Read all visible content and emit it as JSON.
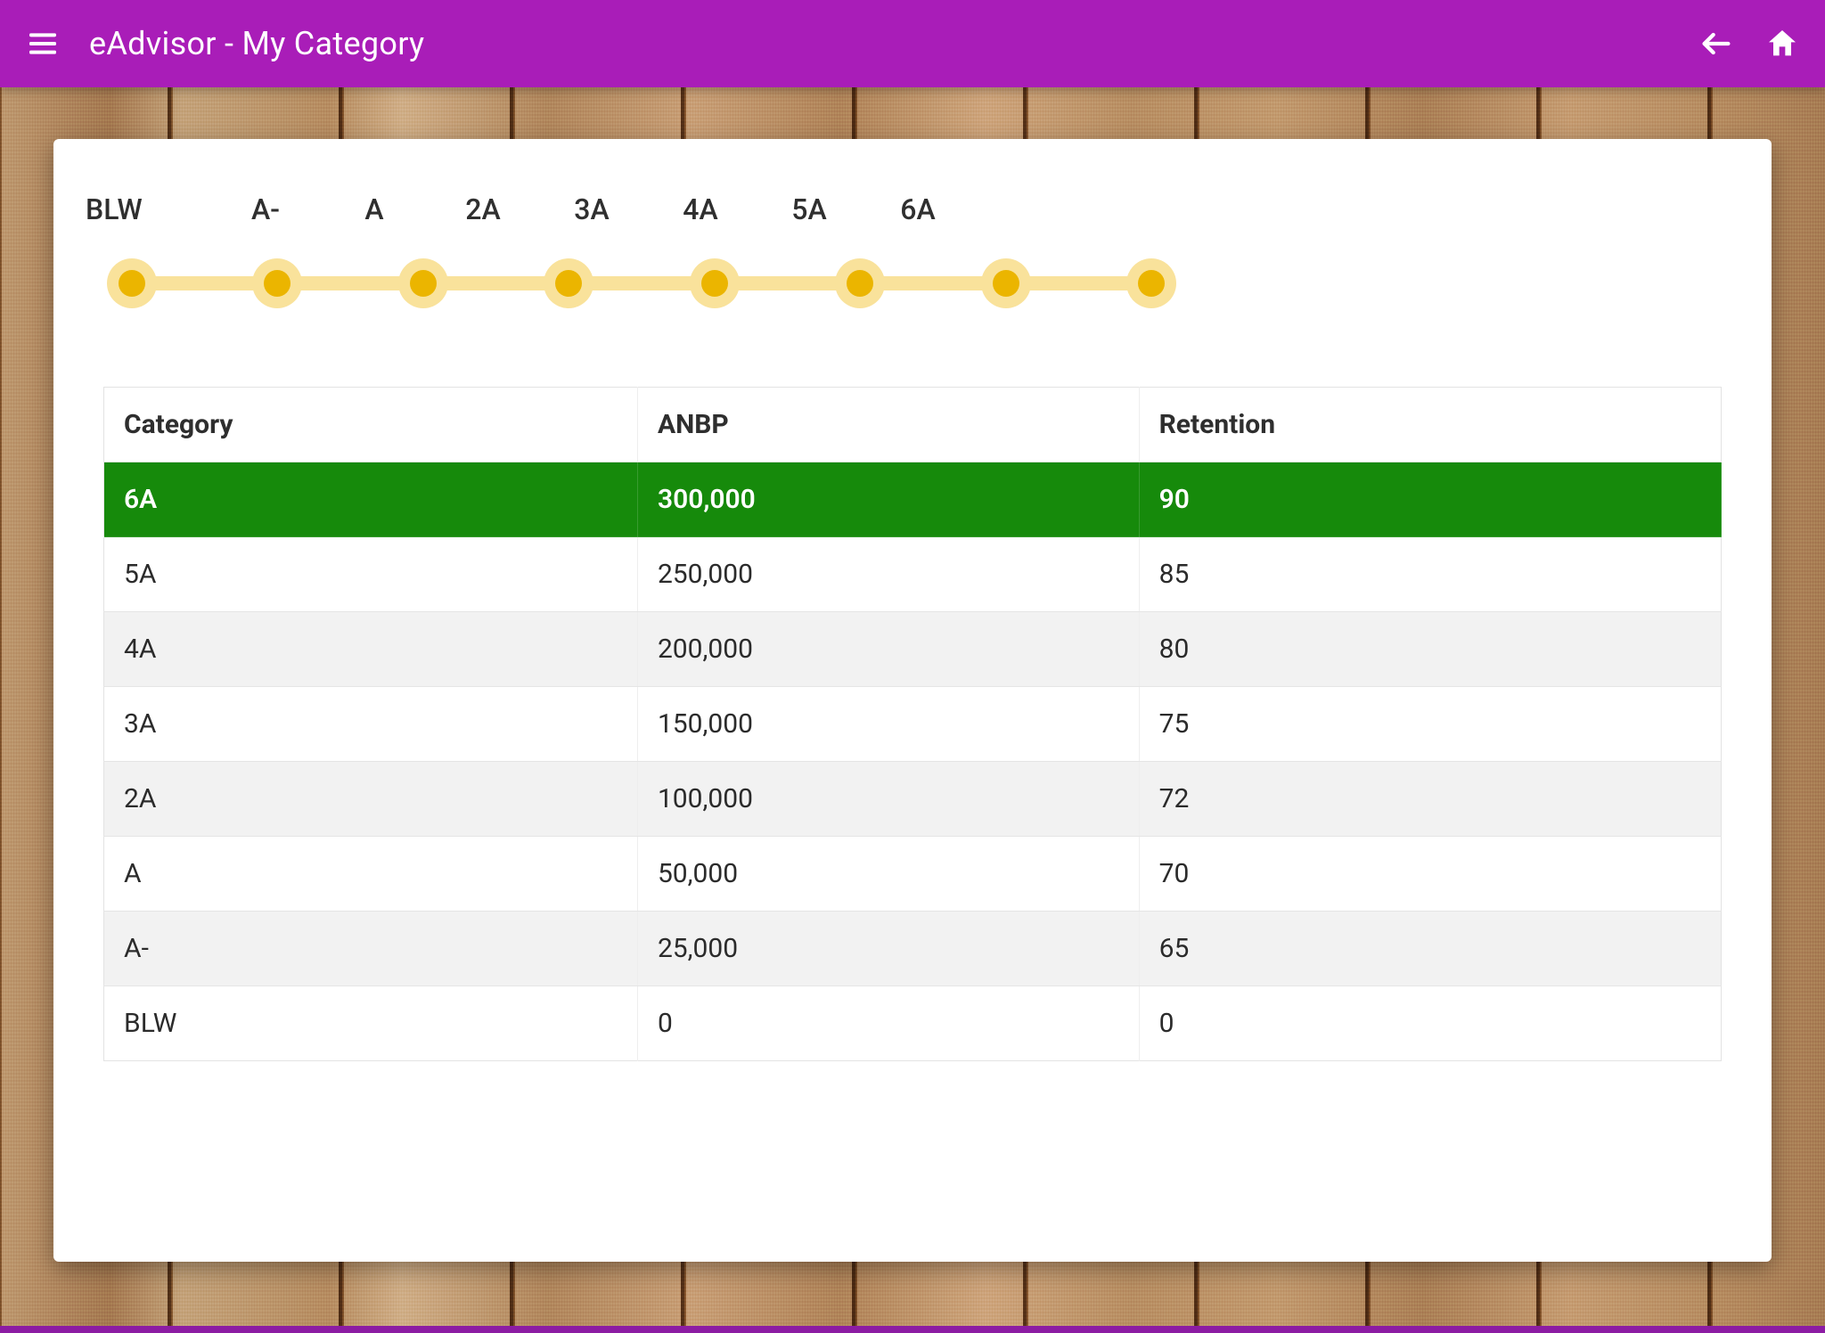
{
  "appbar": {
    "title": "eAdvisor -  My Category"
  },
  "colors": {
    "appbar": "#a91db8",
    "highlight_row": "#168a0b",
    "node_outer": "#f9e29b",
    "node_inner": "#ebb500"
  },
  "stepper": {
    "labels": [
      "BLW",
      "A-",
      "A",
      "2A",
      "3A",
      "4A",
      "5A",
      "6A"
    ]
  },
  "table": {
    "headers": {
      "category": "Category",
      "anbp": "ANBP",
      "retention": "Retention"
    },
    "rows": [
      {
        "category": "6A",
        "anbp": "300,000",
        "retention": "90",
        "highlight": true
      },
      {
        "category": "5A",
        "anbp": "250,000",
        "retention": "85"
      },
      {
        "category": "4A",
        "anbp": "200,000",
        "retention": "80"
      },
      {
        "category": "3A",
        "anbp": "150,000",
        "retention": "75"
      },
      {
        "category": "2A",
        "anbp": "100,000",
        "retention": "72"
      },
      {
        "category": "A",
        "anbp": "50,000",
        "retention": "70"
      },
      {
        "category": "A-",
        "anbp": "25,000",
        "retention": "65"
      },
      {
        "category": "BLW",
        "anbp": "0",
        "retention": "0"
      }
    ]
  }
}
